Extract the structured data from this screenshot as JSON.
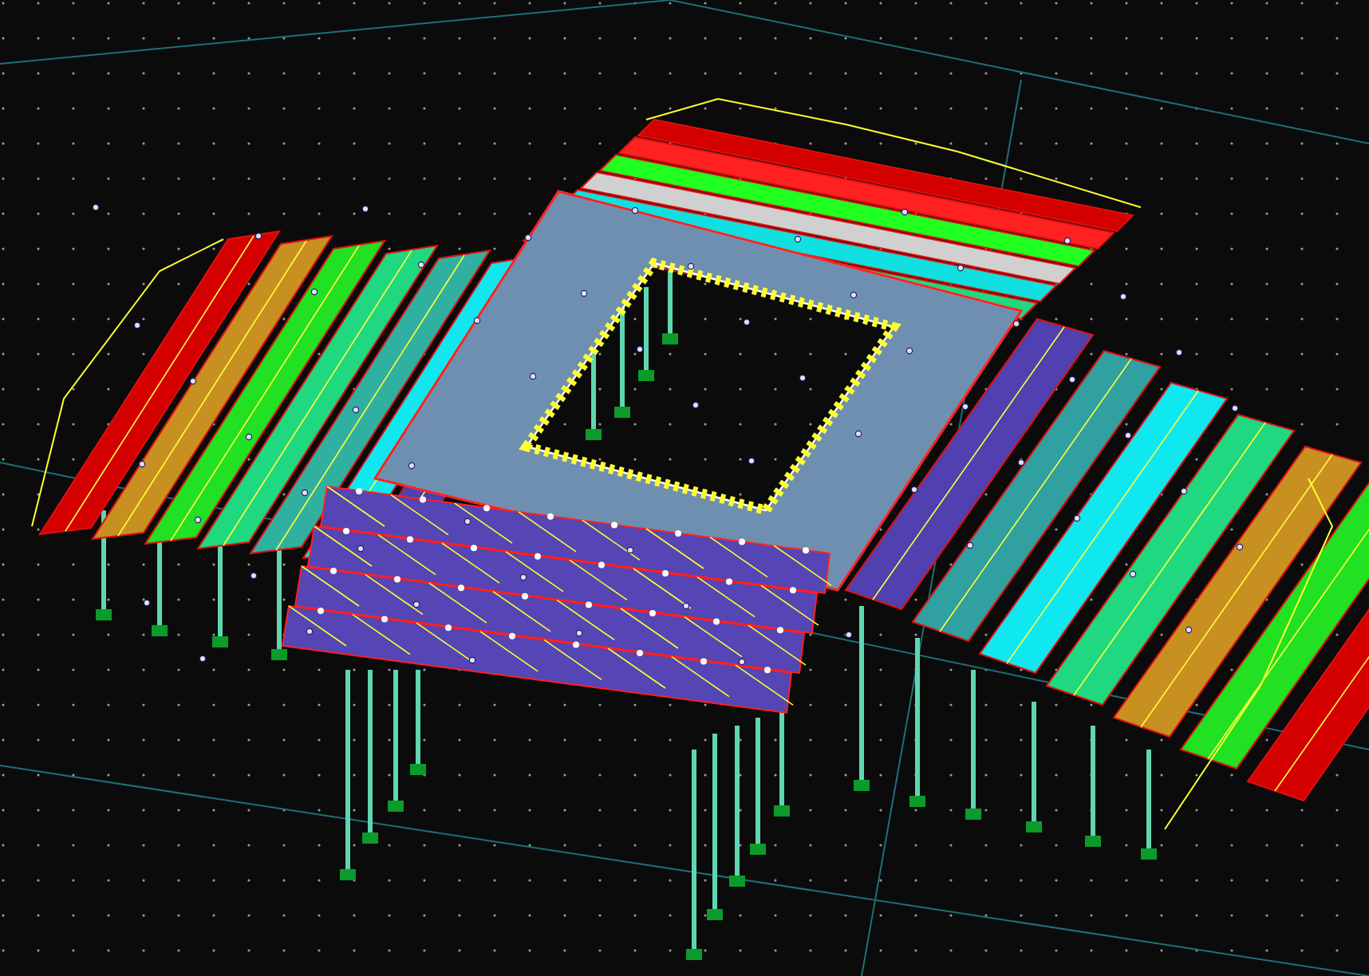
{
  "viewport": {
    "grid": true
  }
}
